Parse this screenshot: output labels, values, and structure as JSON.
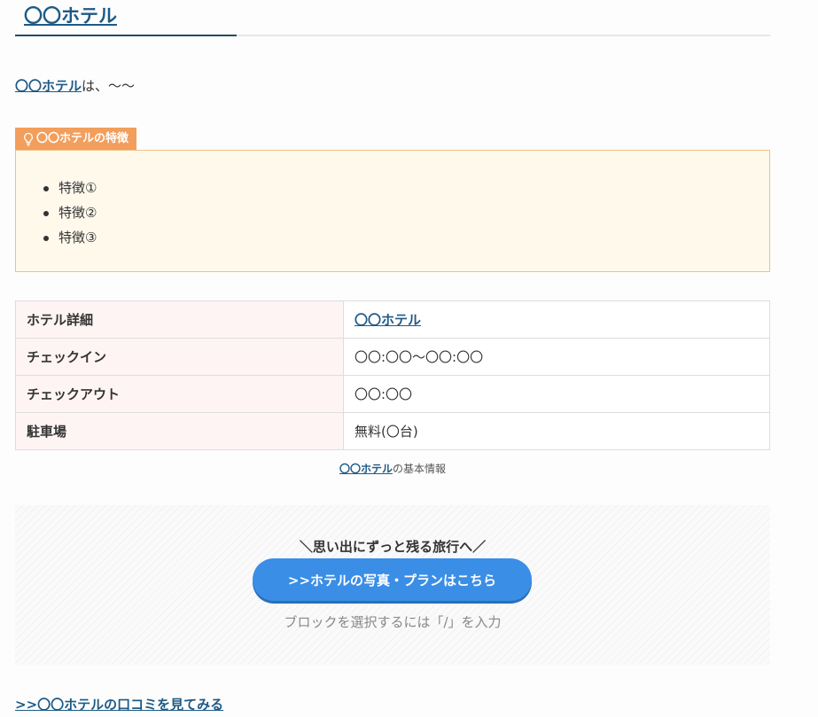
{
  "heading": {
    "title": "〇〇ホテル"
  },
  "intro": {
    "link_text": "〇〇ホテル",
    "text": "は、〜〜"
  },
  "features": {
    "label": "〇〇ホテルの特徴",
    "icon": "lightbulb-icon",
    "items": [
      "特徴①",
      "特徴②",
      "特徴③"
    ]
  },
  "table": {
    "rows": [
      {
        "header": "ホテル詳細",
        "value": "〇〇ホテル",
        "is_link": true
      },
      {
        "header": "チェックイン",
        "value": "〇〇:〇〇〜〇〇:〇〇"
      },
      {
        "header": "チェックアウト",
        "value": "〇〇:〇〇"
      },
      {
        "header": "駐車場",
        "value": "無料(〇台)"
      }
    ],
    "caption_link": "〇〇ホテル",
    "caption_text": "の基本情報"
  },
  "cta": {
    "microcopy": "＼思い出にずっと残る旅行へ／",
    "button_label": ">>ホテルの写真・プランはこちら",
    "hint": "ブロックを選択するには「/」を入力",
    "button_color": "#3a8ee6"
  },
  "reviews_link": ">>〇〇ホテルの口コミを見てみる",
  "colors": {
    "link": "#1e5a86",
    "feature_label_bg": "#f29e5c",
    "feature_box_bg": "#fff9ec",
    "table_header_bg": "#fff4f4"
  }
}
